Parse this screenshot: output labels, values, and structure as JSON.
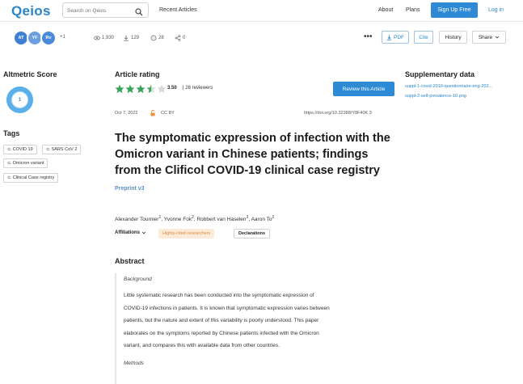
{
  "header": {
    "logo": "Qeios",
    "search_placeholder": "Search on Qeios",
    "recent_articles": "Recent Articles",
    "about": "About",
    "plans": "Plans",
    "signup": "Sign Up Free",
    "login": "Log in"
  },
  "toolbar": {
    "avatars": [
      {
        "initials": "AT",
        "color": "#3f7fd4"
      },
      {
        "initials": "YF",
        "color": "#6b9fe0"
      },
      {
        "initials": "Rv",
        "color": "#4a8ad8"
      }
    ],
    "avatar_more": "+1",
    "views": "1,930",
    "downloads": "129",
    "comments": "28",
    "shares": "0",
    "pdf_label": "PDF",
    "cite_label": "Cite",
    "history_label": "History",
    "share_label": "Share"
  },
  "left": {
    "altmetric_title": "Altmetric Score",
    "altmetric_value": "1",
    "tags_title": "Tags",
    "tags": [
      "COVID 19",
      "SARS CoV 2",
      "Omicron variant",
      "Clinical Case registry"
    ]
  },
  "article": {
    "rating_title": "Article rating",
    "rating_value": "3.50",
    "stars_fraction": 0.7,
    "reviewers": "| 26 reviewers",
    "review_button": "Review this Article",
    "date": "Oct 7, 2022",
    "license": "CC BY",
    "doi": "https://doi.org/10.32388/Y8F40K.3",
    "title": "The symptomatic expression of infection with the Omicron variant in Chinese patients; findings from the Clificol COVID-19 clinical case registry",
    "preprint": "Preprint v3",
    "authors": [
      {
        "name": "Alexander Tournier",
        "sup": "1"
      },
      {
        "name": "Yvonne Fok",
        "sup": "2"
      },
      {
        "name": "Robbert van Haselen",
        "sup": "3"
      },
      {
        "name": "Aaron To",
        "sup": "2"
      }
    ],
    "affiliations": "Affiliations",
    "highly_cited": "Highly-cited researchers",
    "declarations": "Declarations",
    "abstract_title": "Abstract",
    "background_label": "Background",
    "abstract_lines": [
      "Little systematic research has been conducted into the symptomatic expression of",
      "COVID-19 infections in patients. It is known that symptomatic expression varies between",
      "patients, but the nature and extent of this variability is poorly understood. This paper",
      "elaborates on the symptoms reported by Chinese patients infected with the Omicron",
      "variant, and compares this with available data from other countries."
    ],
    "methods_label": "Methods"
  },
  "right": {
    "supp_title": "Supplementary data",
    "files": [
      "suppl-1-covid-2019-questionnaire-eng-202...",
      "suppl-2-self-prevalence-10.png"
    ]
  }
}
